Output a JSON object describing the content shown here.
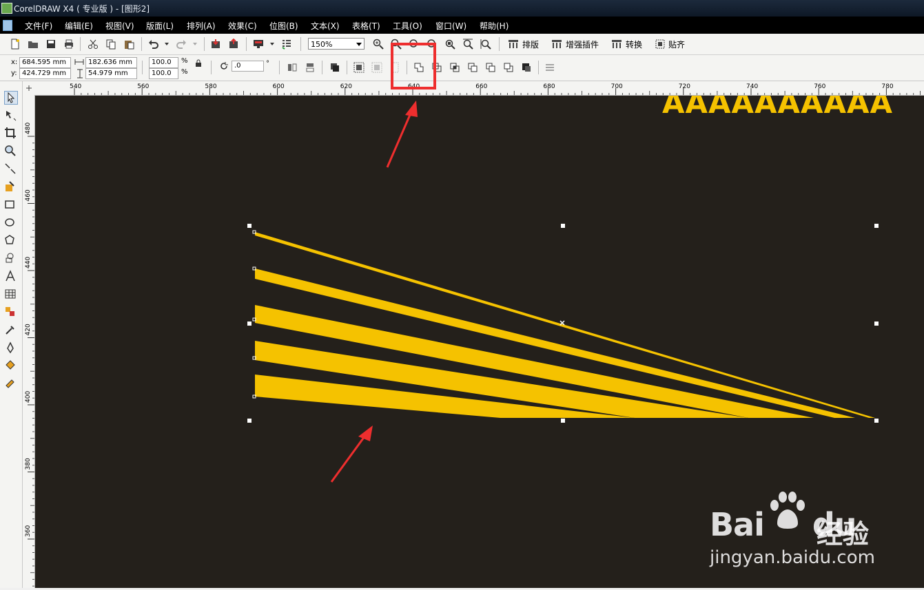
{
  "titlebar": {
    "title": "CorelDRAW X4 ( 专业版 ) - [图形2]"
  },
  "menu": [
    "文件(F)",
    "编辑(E)",
    "视图(V)",
    "版面(L)",
    "排列(A)",
    "效果(C)",
    "位图(B)",
    "文本(X)",
    "表格(T)",
    "工具(O)",
    "窗口(W)",
    "帮助(H)"
  ],
  "toolbar": {
    "zoom": "150%",
    "layout_label": "排版",
    "plugin_label": "增强插件",
    "convert_label": "转换",
    "snap_label": "贴齐"
  },
  "propbar": {
    "x_label": "x:",
    "y_label": "y:",
    "x_value": "684.595 mm",
    "y_value": "424.729 mm",
    "width_value": "182.636 mm",
    "height_value": "54.979 mm",
    "scale_x": "100.0",
    "scale_y": "100.0",
    "percent": "%",
    "rotation": ".0",
    "degree": "°"
  },
  "hruler_ticks": [
    "540",
    "560",
    "580",
    "600",
    "620",
    "640",
    "660",
    "680",
    "700",
    "720",
    "740",
    "760",
    "780"
  ],
  "vruler_ticks": [
    "480",
    "460",
    "440",
    "420",
    "400",
    "380",
    "360"
  ],
  "canvas": {
    "text_sample": "AAAAAAAAAA",
    "shape_color": "#f5c200",
    "background_color": "#24201b"
  },
  "watermark": {
    "logo_text": "Bai",
    "logo_text2": "du",
    "cn_text": "经验",
    "url_text": "jingyan.baidu.com"
  },
  "colors": {
    "highlight": "#ee2e2e",
    "arrow": "#ee2e2e"
  }
}
